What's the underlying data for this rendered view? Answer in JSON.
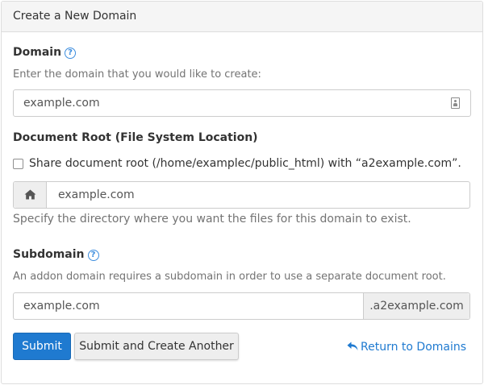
{
  "panel": {
    "title": "Create a New Domain"
  },
  "domain": {
    "label": "Domain",
    "help": "Enter the domain that you would like to create:",
    "value": "example.com"
  },
  "docroot": {
    "label": "Document Root (File System Location)",
    "share_label": "Share document root (/home/examplec/public_html) with “a2example.com”.",
    "share_checked": false,
    "value": "example.com",
    "help": "Specify the directory where you want the files for this domain to exist."
  },
  "subdomain": {
    "label": "Subdomain",
    "help": "An addon domain requires a subdomain in order to use a separate document root.",
    "value": "example.com",
    "suffix": ".a2example.com"
  },
  "actions": {
    "submit_label": "Submit",
    "submit_another_label": "Submit and Create Another",
    "return_label": "Return to Domains"
  },
  "colors": {
    "accent": "#1f7ad0",
    "help_icon": "#3c8dde"
  },
  "icons": {
    "domain_field": "contact-card-icon",
    "docroot_addon": "home-icon",
    "return_link": "reply-arrow-icon",
    "help": "question-circle-icon"
  }
}
